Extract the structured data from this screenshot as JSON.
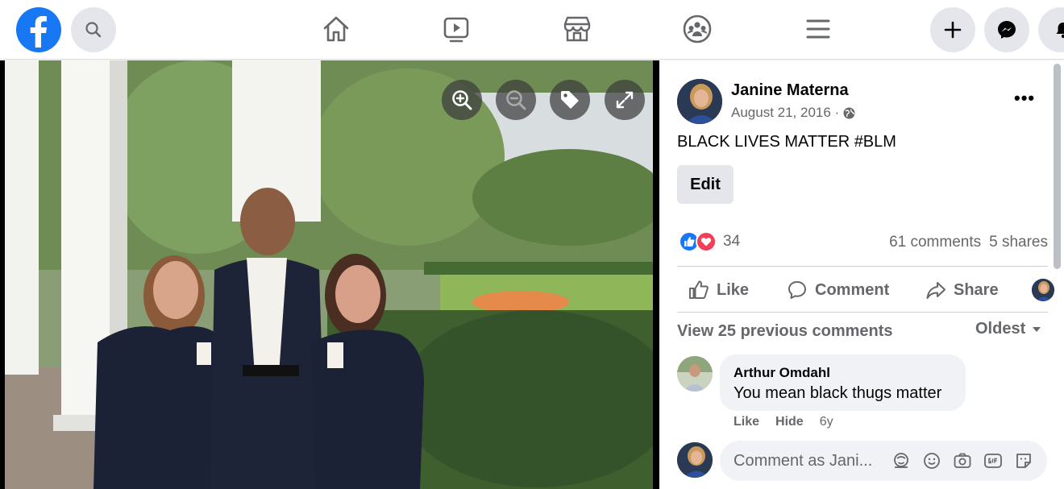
{
  "post": {
    "author": "Janine Materna",
    "date": "August 21, 2016 ·",
    "text_plain": "BLACK LIVES MATTER ",
    "hashtag": "#BLM",
    "edit_label": "Edit",
    "reaction_count": "34",
    "comments_count": "61 comments",
    "shares_count": "5 shares"
  },
  "actions": {
    "like": "Like",
    "comment": "Comment",
    "share": "Share"
  },
  "comments": {
    "view_previous": "View 25 previous comments",
    "sort_label": "Oldest",
    "items": [
      {
        "author": "Arthur Omdahl",
        "text": "You mean black thugs matter",
        "like": "Like",
        "hide": "Hide",
        "time": "6y"
      }
    ],
    "composer_placeholder": "Comment as Jani..."
  },
  "colors": {
    "brand": "#1877f2",
    "love": "#f33e58",
    "text_secondary": "#65676b"
  }
}
